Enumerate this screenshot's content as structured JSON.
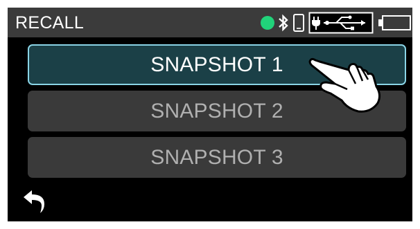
{
  "screen": {
    "title": "RECALL"
  },
  "status": {
    "indicator_color": "#21d37a",
    "icons": [
      "status-dot-icon",
      "bluetooth-icon",
      "phone-icon",
      "usb-power-icon",
      "battery-icon"
    ]
  },
  "snapshots": [
    {
      "label": "SNAPSHOT 1",
      "selected": true
    },
    {
      "label": "SNAPSHOT 2",
      "selected": false
    },
    {
      "label": "SNAPSHOT 3",
      "selected": false
    }
  ],
  "footer": {
    "back_icon": "back-arrow-icon"
  },
  "colors": {
    "selected_fill": "#1b4047",
    "selected_border": "#8ad4e6",
    "button_fill": "#3a3a3a",
    "status_bar": "#3b3b3b"
  }
}
